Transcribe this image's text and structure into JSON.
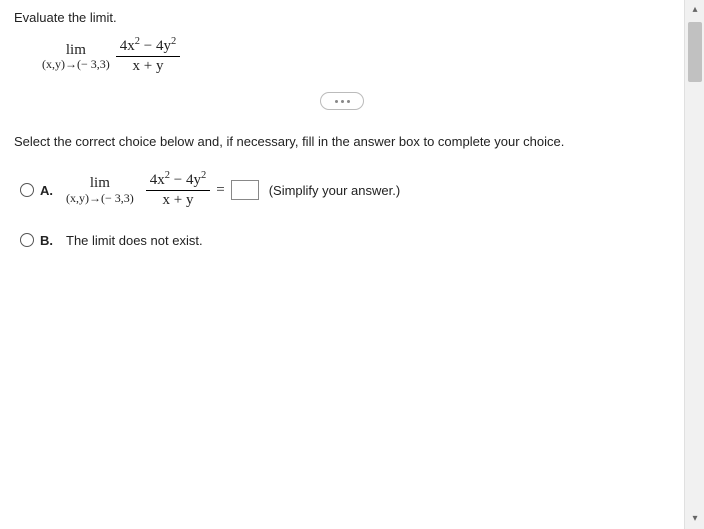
{
  "prompt": "Evaluate the limit.",
  "limit_expr": {
    "lim_label": "lim",
    "approach": "(x,y)→(− 3,3)",
    "numerator_html": "4x<sup>2</sup> − 4y<sup>2</sup>",
    "denominator": "x + y"
  },
  "instruction": "Select the correct choice below and, if necessary, fill in the answer box to complete your choice.",
  "choices": {
    "a": {
      "label": "A.",
      "lim_label": "lim",
      "approach": "(x,y)→(− 3,3)",
      "numerator_html": "4x<sup>2</sup> − 4y<sup>2</sup>",
      "denominator": "x + y",
      "equals": "=",
      "hint": "(Simplify your answer.)",
      "answer_value": ""
    },
    "b": {
      "label": "B.",
      "text": "The limit does not exist."
    }
  }
}
